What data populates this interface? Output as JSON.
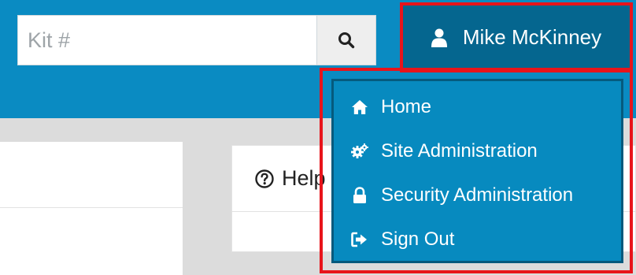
{
  "header": {
    "search": {
      "placeholder": "Kit #",
      "value": ""
    },
    "search_button_icon": "search-icon",
    "user": {
      "name": "Mike McKinney",
      "icon": "user-icon"
    }
  },
  "user_dropdown": {
    "items": [
      {
        "label": "Home",
        "icon": "home-icon"
      },
      {
        "label": "Site Administration",
        "icon": "gears-icon"
      },
      {
        "label": "Security Administration",
        "icon": "lock-icon"
      },
      {
        "label": "Sign Out",
        "icon": "sign-out-icon"
      }
    ]
  },
  "panels": {
    "help": {
      "title": "Help",
      "icon": "question-circle-icon"
    }
  },
  "colors": {
    "topbar": "#0a8bc2",
    "user_menu": "#05668f",
    "dropdown": "#078abf",
    "highlight": "#e8141b"
  }
}
